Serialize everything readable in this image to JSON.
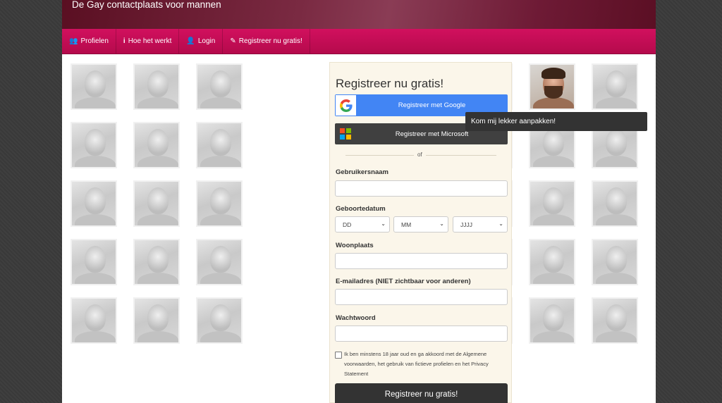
{
  "header": {
    "title": "De Gay contactplaats voor mannen"
  },
  "nav": [
    {
      "label": "Profielen",
      "icon": "users-icon"
    },
    {
      "label": "Hoe het werkt",
      "icon": "info-icon"
    },
    {
      "label": "Login",
      "icon": "user-icon"
    },
    {
      "label": "Registreer nu gratis!",
      "icon": "edit-icon"
    }
  ],
  "tooltip": {
    "text": "Kom mij lekker aanpakken!"
  },
  "form": {
    "title": "Registreer nu gratis!",
    "google_label": "Registreer met Google",
    "microsoft_label": "Registreer met Microsoft",
    "divider_text": "of",
    "username_label": "Gebruikersnaam",
    "birthdate_label": "Geboortedatum",
    "day_value": "DD",
    "month_value": "MM",
    "year_value": "JJJJ",
    "city_label": "Woonplaats",
    "email_label": "E-mailadres (NIET zichtbaar voor anderen)",
    "password_label": "Wachtwoord",
    "terms_text": "Ik ben minstens 18 jaar oud en ga akkoord met de Algemene voorwaarden, het gebruik van fictieve profielen en het Privacy Statement",
    "submit_label": "Registreer nu gratis!"
  },
  "colors": {
    "navbar": "#c20c55",
    "banner": "#6e1a35",
    "google": "#4285f4",
    "microsoft": "#404040",
    "form_bg": "#fbf6ea",
    "submit": "#333333"
  }
}
